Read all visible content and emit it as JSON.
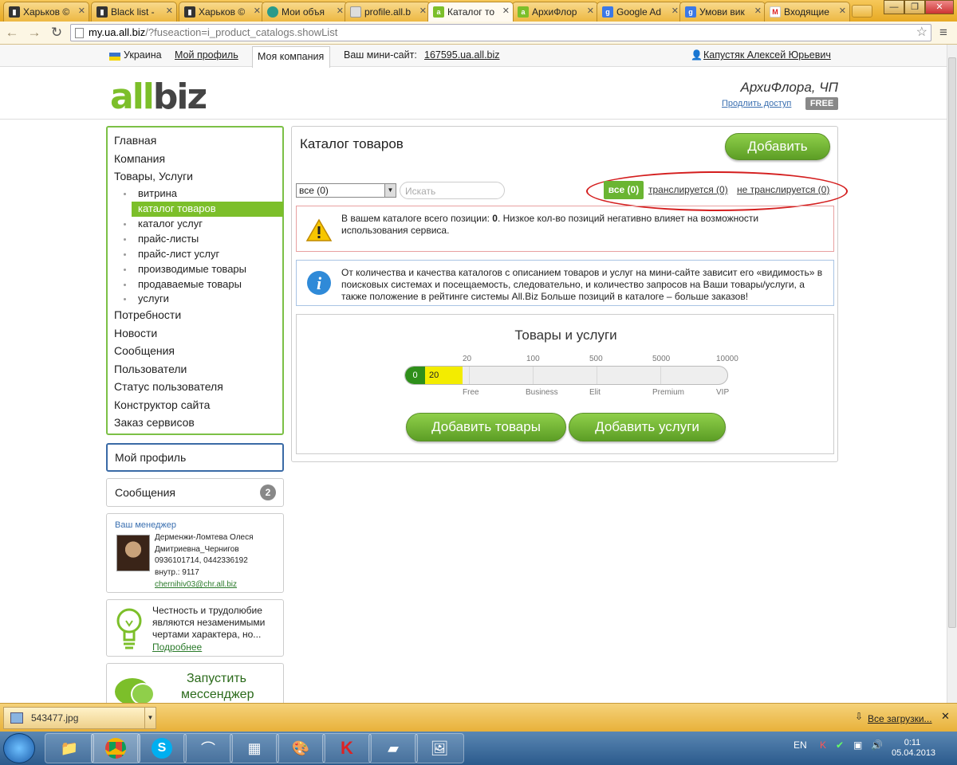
{
  "browser": {
    "tabs": [
      {
        "title": "Харьков ©"
      },
      {
        "title": "Black list -"
      },
      {
        "title": "Харьков ©"
      },
      {
        "title": "Мои объя"
      },
      {
        "title": "profile.all.b"
      },
      {
        "title": "Каталог то"
      },
      {
        "title": "АрхиФлор"
      },
      {
        "title": "Google Ad"
      },
      {
        "title": "Умови вик"
      },
      {
        "title": "Входящие"
      }
    ],
    "url_host": "my.ua.all.biz",
    "url_path": "/?fuseaction=i_product_catalogs.showList"
  },
  "topbar": {
    "country": "Украина",
    "my_profile": "Мой профиль",
    "my_company": "Моя компания",
    "minisite_label": "Ваш мини-сайт:",
    "minisite_url": "167595.ua.all.biz",
    "user_name": "Капустяк Алексей Юрьевич"
  },
  "header": {
    "logo_a": "all",
    "logo_b": "biz",
    "company_name": "АрхиФлора, ЧП",
    "extend_access": "Продлить доступ",
    "plan_badge": "FREE"
  },
  "leftmenu": {
    "items": [
      "Главная",
      "Компания",
      "Товары, Услуги"
    ],
    "subitems": [
      "витрина",
      "каталог товаров",
      "каталог услуг",
      "прайс-листы",
      "прайс-лист услуг",
      "производимые товары",
      "продаваемые товары",
      "услуги"
    ],
    "items2": [
      "Потребности",
      "Новости",
      "Сообщения",
      "Пользователи",
      "Статус пользователя",
      "Конструктор сайта",
      "Заказ сервисов"
    ]
  },
  "sidebar": {
    "my_profile": "Мой профиль",
    "messages_label": "Сообщения",
    "messages_count": "2",
    "manager_title": "Ваш менеджер",
    "manager_lines": [
      "Дерменжи-Ломтева Олеся",
      "Дмитриевна_Чернигов",
      "0936101714, 0442336192",
      "внутр.: 9117"
    ],
    "manager_email": "chernihiv03@chr.all.biz",
    "tip_lines": [
      "Честность и трудолюбие",
      "являются незаменимыми",
      "чертами характера, но..."
    ],
    "tip_more": "Подробнее",
    "messenger_lines": [
      "Запустить",
      "мессенджер"
    ]
  },
  "main": {
    "title": "Каталог товаров",
    "add_button": "Добавить",
    "select_value": "все (0)",
    "search_placeholder": "Искать",
    "filter_all": "все (0)",
    "filter_broadcast": "транслируется (0)",
    "filter_not_broadcast": "не транслируется (0)",
    "warning_prefix": "В вашем каталоге всего позиции: ",
    "warning_count": "0",
    "warning_suffix": ". Низкое кол-во позиций негативно влияет на возможности",
    "warning_line2": "использования сервиса.",
    "info_lines": [
      "От количества и качества каталогов с описанием товаров и услуг на мини-сайте зависит его «видимость» в",
      "поисковых системах и посещаемость, следовательно, и количество запросов на Ваши товары/услуги, а",
      "также положение в рейтинге системы All.Biz Больше позиций в каталоге – больше заказов!"
    ],
    "progress_title": "Товары и услуги",
    "progress_current": "0",
    "progress_fraction": 0.0,
    "threshold_label": "20",
    "tick_values": [
      "20",
      "100",
      "500",
      "5000",
      "10000"
    ],
    "tick_labels": [
      "Free",
      "Business",
      "Elit",
      "Premium",
      "VIP"
    ],
    "add_goods": "Добавить товары",
    "add_services": "Добавить услуги"
  },
  "downloads": {
    "file": "543477.jpg",
    "all": "Все загрузки..."
  },
  "taskbar": {
    "lang": "EN",
    "time": "0:11",
    "date": "05.04.2013"
  },
  "colors": {
    "brand_green": "#7cbf2a",
    "annotation_red": "#d41e1e",
    "browser_orange": "#e7a923"
  }
}
